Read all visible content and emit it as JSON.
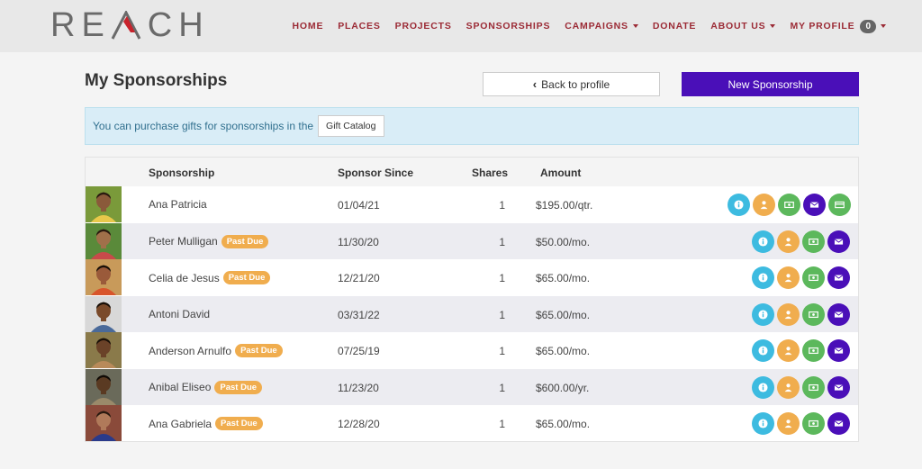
{
  "brand": {
    "logo_text": "REACH"
  },
  "nav": {
    "items": [
      {
        "label": "HOME"
      },
      {
        "label": "PLACES"
      },
      {
        "label": "PROJECTS"
      },
      {
        "label": "SPONSORSHIPS"
      },
      {
        "label": "CAMPAIGNS",
        "dropdown": true
      },
      {
        "label": "DONATE"
      },
      {
        "label": "ABOUT US",
        "dropdown": true
      },
      {
        "label": "MY PROFILE",
        "dropdown": true,
        "badge": "0"
      }
    ]
  },
  "page": {
    "title": "My Sponsorships",
    "back_label": "Back to profile",
    "new_label": "New Sponsorship"
  },
  "alert": {
    "text": "You can purchase gifts for sponsorships in the",
    "button_label": "Gift Catalog"
  },
  "table": {
    "headers": [
      "Sponsorship",
      "Sponsor Since",
      "Shares",
      "Amount"
    ],
    "past_due_label": "Past Due",
    "rows": [
      {
        "name": "Ana Patricia",
        "past_due": false,
        "since": "01/04/21",
        "shares": "1",
        "amount": "$195.00/qtr.",
        "has_card": true
      },
      {
        "name": "Peter Mulligan",
        "past_due": true,
        "since": "11/30/20",
        "shares": "1",
        "amount": "$50.00/mo.",
        "has_card": false
      },
      {
        "name": "Celia de Jesus",
        "past_due": true,
        "since": "12/21/20",
        "shares": "1",
        "amount": "$65.00/mo.",
        "has_card": false
      },
      {
        "name": "Antoni David",
        "past_due": false,
        "since": "03/31/22",
        "shares": "1",
        "amount": "$65.00/mo.",
        "has_card": false
      },
      {
        "name": "Anderson Arnulfo",
        "past_due": true,
        "since": "07/25/19",
        "shares": "1",
        "amount": "$65.00/mo.",
        "has_card": false
      },
      {
        "name": "Anibal Eliseo",
        "past_due": true,
        "since": "11/23/20",
        "shares": "1",
        "amount": "$600.00/yr.",
        "has_card": false
      },
      {
        "name": "Ana Gabriela",
        "past_due": true,
        "since": "12/28/20",
        "shares": "1",
        "amount": "$65.00/mo.",
        "has_card": false
      }
    ]
  },
  "colors": {
    "nav_text": "#9b2a35",
    "primary": "#4a0fb8",
    "info": "#3dbbe0",
    "warning": "#f0ad4e",
    "success": "#5cb85c"
  },
  "icons": [
    "info-icon",
    "user-icon",
    "money-icon",
    "envelope-icon",
    "credit-card-icon",
    "chevron-left-icon",
    "caret-down-icon"
  ]
}
